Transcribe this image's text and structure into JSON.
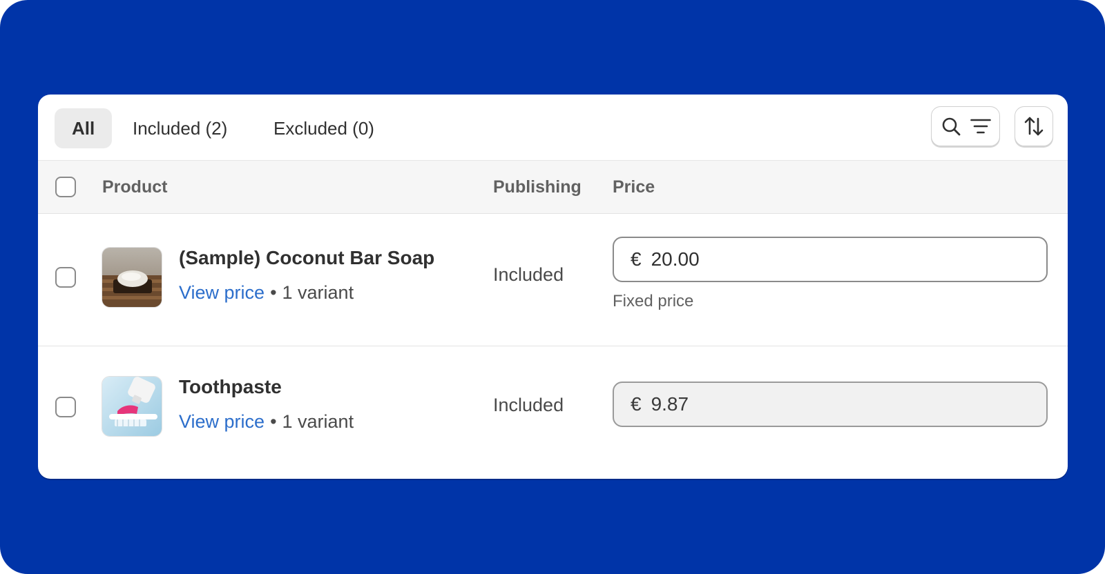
{
  "tabs": [
    {
      "label": "All",
      "active": true
    },
    {
      "label": "Included (2)",
      "active": false
    },
    {
      "label": "Excluded (0)",
      "active": false
    }
  ],
  "toolbar": {
    "search_filter_icons": [
      "search-icon",
      "filter-icon"
    ],
    "sort_icon": "sort-icon"
  },
  "table": {
    "headers": {
      "product": "Product",
      "publishing": "Publishing",
      "price": "Price"
    },
    "rows": [
      {
        "name": "(Sample) Coconut Bar Soap",
        "view_price": "View price",
        "bullet": "•",
        "variants": "1 variant",
        "publishing": "Included",
        "currency": "€",
        "price": "20.00",
        "price_note": "Fixed price",
        "price_editable": true,
        "thumbnail": "soap-image"
      },
      {
        "name": "Toothpaste",
        "view_price": "View price",
        "bullet": "•",
        "variants": "1 variant",
        "publishing": "Included",
        "currency": "€",
        "price": "9.87",
        "price_editable": false,
        "thumbnail": "toothpaste-image"
      }
    ]
  },
  "colors": {
    "backdrop": "#0034a8",
    "link": "#2c6ecb",
    "header_bg": "#f6f6f6",
    "active_tab_bg": "#ebebeb"
  }
}
